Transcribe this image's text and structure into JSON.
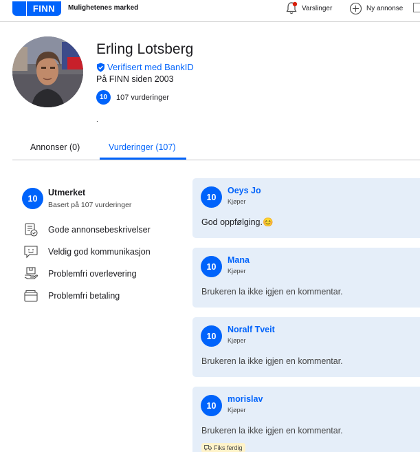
{
  "header": {
    "logo_text": "FINN",
    "tagline": "Mulighetenes marked",
    "notifications_label": "Varslinger",
    "new_ad_label": "Ny annonse",
    "brand_color": "#0063fb",
    "notification_dot_color": "#d91f0a"
  },
  "profile": {
    "name": "Erling Lotsberg",
    "verified": "Verifisert med BankID",
    "member_since": "På FINN siden 2003",
    "score": "10",
    "ratings_count": "107 vurderinger",
    "dot": "."
  },
  "tabs": [
    {
      "label": "Annonser (0)",
      "active": false
    },
    {
      "label": "Vurderinger (107)",
      "active": true
    }
  ],
  "summary": {
    "score": "10",
    "title": "Utmerket",
    "subtitle": "Basert på 107 vurderinger",
    "features": [
      {
        "icon": "document-check-icon",
        "label": "Gode annonsebeskrivelser"
      },
      {
        "icon": "chat-smile-icon",
        "label": "Veldig god kommunikasjon"
      },
      {
        "icon": "handover-box-icon",
        "label": "Problemfri overlevering"
      },
      {
        "icon": "wallet-icon",
        "label": "Problemfri betaling"
      }
    ]
  },
  "reviews": [
    {
      "score": "10",
      "reviewer": "Oeys Jo",
      "role": "Kjøper",
      "comment": "God oppfølging.😊"
    },
    {
      "score": "10",
      "reviewer": "Mana",
      "role": "Kjøper",
      "comment": "Brukeren la ikke igjen en kommentar."
    },
    {
      "score": "10",
      "reviewer": "Noralf Tveit",
      "role": "Kjøper",
      "comment": "Brukeren la ikke igjen en kommentar."
    },
    {
      "score": "10",
      "reviewer": "morislav",
      "role": "Kjøper",
      "comment": "Brukeren la ikke igjen en kommentar.",
      "tag": "Fiks ferdig"
    }
  ]
}
